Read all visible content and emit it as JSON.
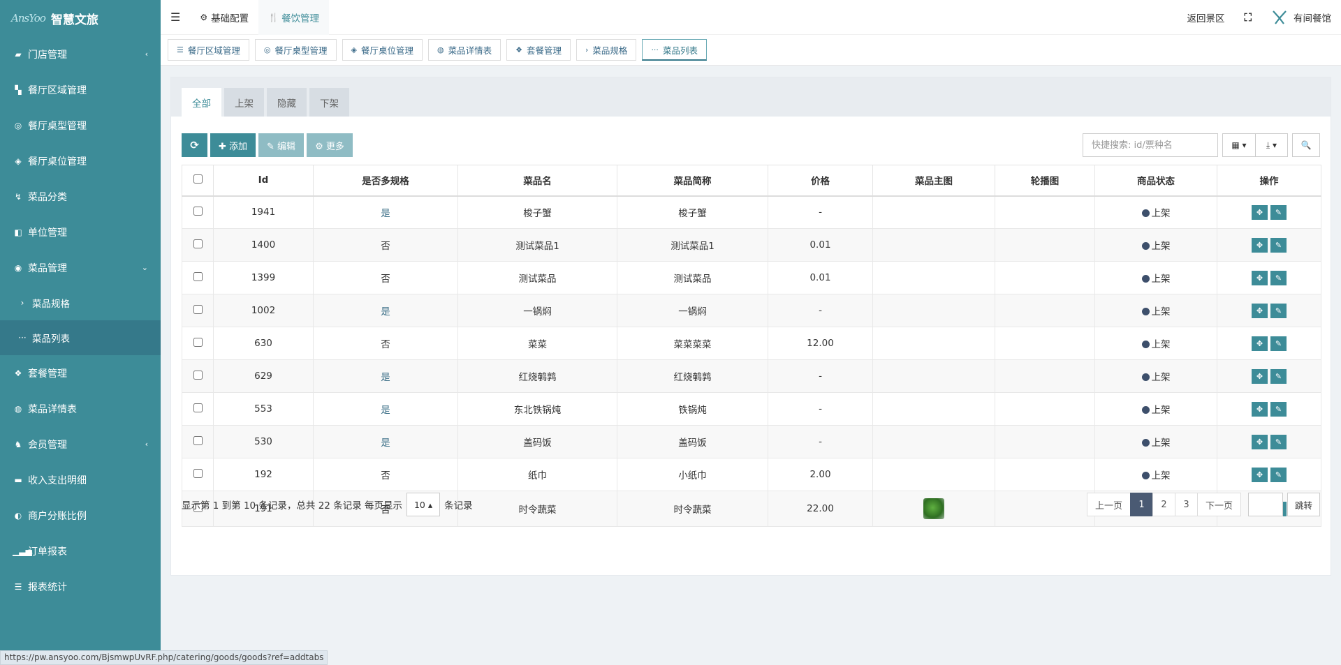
{
  "brand": {
    "logo_mark": "AnsYoo",
    "title": "智慧文旅"
  },
  "sidebar": {
    "items": [
      {
        "icon": "▰",
        "label": "门店管理",
        "arrow": "‹"
      },
      {
        "icon": "▚",
        "label": "餐厅区域管理",
        "arrow": ""
      },
      {
        "icon": "◎",
        "label": "餐厅桌型管理",
        "arrow": ""
      },
      {
        "icon": "◈",
        "label": "餐厅桌位管理",
        "arrow": ""
      },
      {
        "icon": "↯",
        "label": "菜品分类",
        "arrow": ""
      },
      {
        "icon": "◧",
        "label": "单位管理",
        "arrow": ""
      },
      {
        "icon": "◉",
        "label": "菜品管理",
        "arrow": "⌄"
      },
      {
        "icon": "›",
        "label": "菜品规格",
        "arrow": ""
      },
      {
        "icon": "···",
        "label": "菜品列表",
        "arrow": ""
      },
      {
        "icon": "❖",
        "label": "套餐管理",
        "arrow": ""
      },
      {
        "icon": "◍",
        "label": "菜品详情表",
        "arrow": ""
      },
      {
        "icon": "♞",
        "label": "会员管理",
        "arrow": "‹"
      },
      {
        "icon": "▬",
        "label": "收入支出明细",
        "arrow": ""
      },
      {
        "icon": "◐",
        "label": "商户分账比例",
        "arrow": ""
      },
      {
        "icon": "▁▃▅",
        "label": "订单报表",
        "arrow": ""
      },
      {
        "icon": "☰",
        "label": "报表统计",
        "arrow": ""
      }
    ]
  },
  "topbar": {
    "menu_icon": "☰",
    "items": [
      {
        "icon": "⚙",
        "label": "基础配置"
      },
      {
        "icon": "🍴",
        "label": "餐饮管理"
      }
    ],
    "back_label": "返回景区",
    "fullscreen_icon": "⛶",
    "user_label": "有间餐馆"
  },
  "page_tabs": [
    {
      "icon": "☰",
      "label": "餐厅区域管理"
    },
    {
      "icon": "◎",
      "label": "餐厅桌型管理"
    },
    {
      "icon": "◈",
      "label": "餐厅桌位管理"
    },
    {
      "icon": "◍",
      "label": "菜品详情表"
    },
    {
      "icon": "❖",
      "label": "套餐管理"
    },
    {
      "icon": "›",
      "label": "菜品规格"
    },
    {
      "icon": "···",
      "label": "菜品列表"
    }
  ],
  "filter_tabs": [
    "全部",
    "上架",
    "隐藏",
    "下架"
  ],
  "toolbar": {
    "refresh_icon": "⟳",
    "add_label": "✚ 添加",
    "edit_label": "✎ 编辑",
    "more_label": "⚙ 更多",
    "search_placeholder": "快捷搜索: id/票种名",
    "columns_icon": "▦ ▾",
    "export_icon": "⤓ ▾",
    "search_icon": "🔍"
  },
  "table": {
    "headers": [
      "Id",
      "是否多规格",
      "菜品名",
      "菜品简称",
      "价格",
      "菜品主图",
      "轮播图",
      "商品状态",
      "操作"
    ],
    "rows": [
      {
        "id": "1941",
        "multi": "是",
        "name": "梭子蟹",
        "short": "梭子蟹",
        "price": "-",
        "status": "上架"
      },
      {
        "id": "1400",
        "multi": "否",
        "name": "测试菜品1",
        "short": "测试菜品1",
        "price": "0.01",
        "status": "上架"
      },
      {
        "id": "1399",
        "multi": "否",
        "name": "测试菜品",
        "short": "测试菜品",
        "price": "0.01",
        "status": "上架"
      },
      {
        "id": "1002",
        "multi": "是",
        "name": "一锅焖",
        "short": "一锅焖",
        "price": "-",
        "status": "上架"
      },
      {
        "id": "630",
        "multi": "否",
        "name": "菜菜",
        "short": "菜菜菜菜",
        "price": "12.00",
        "status": "上架"
      },
      {
        "id": "629",
        "multi": "是",
        "name": "红烧鹌鹑",
        "short": "红烧鹌鹑",
        "price": "-",
        "status": "上架"
      },
      {
        "id": "553",
        "multi": "是",
        "name": "东北铁锅炖",
        "short": "铁锅炖",
        "price": "-",
        "status": "上架"
      },
      {
        "id": "530",
        "multi": "是",
        "name": "盖码饭",
        "short": "盖码饭",
        "price": "-",
        "status": "上架"
      },
      {
        "id": "192",
        "multi": "否",
        "name": "纸巾",
        "short": "小纸巾",
        "price": "2.00",
        "status": "上架"
      },
      {
        "id": "191",
        "multi": "否",
        "name": "时令蔬菜",
        "short": "时令蔬菜",
        "price": "22.00",
        "status": "上架"
      }
    ]
  },
  "footer": {
    "summary": "显示第 1 到第 10 条记录，总共 22 条记录 每页显示",
    "page_size": "10 ▴",
    "suffix": "条记录",
    "prev": "上一页",
    "pages": [
      "1",
      "2",
      "3"
    ],
    "next": "下一页",
    "jump": "跳转"
  },
  "status_url": "https://pw.ansyoo.com/BjsmwpUvRF.php/catering/goods/goods?ref=addtabs",
  "colors": {
    "accent": "#3d8c98",
    "sidebar": "#3d8c98",
    "pager_active": "#4a5a73"
  }
}
